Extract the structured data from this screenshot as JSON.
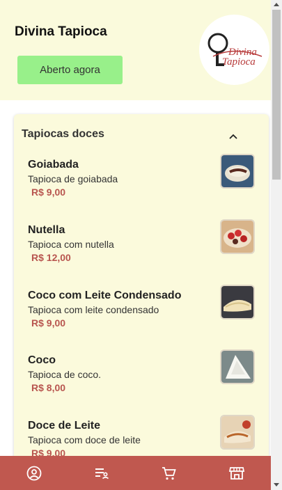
{
  "store": {
    "name": "Divina Tapioca",
    "status": "Aberto agora",
    "logo_text_line1": "Divina",
    "logo_text_line2": "Tapioca"
  },
  "category": {
    "title": "Tapiocas doces",
    "expanded": true,
    "items": [
      {
        "name": "Goiabada",
        "description": "Tapioca de goiabada",
        "price": "R$ 9,00",
        "image": "tapioca-goiabada-photo"
      },
      {
        "name": "Nutella",
        "description": "Tapioca com nutella",
        "price": "R$ 12,00",
        "image": "tapioca-nutella-photo"
      },
      {
        "name": "Coco com Leite Condensado",
        "description": "Tapioca com leite condensado",
        "price": "R$ 9,00",
        "image": "tapioca-coco-leite-photo"
      },
      {
        "name": "Coco",
        "description": "Tapioca de coco.",
        "price": "R$ 8,00",
        "image": "tapioca-coco-photo"
      },
      {
        "name": "Doce de Leite",
        "description": "Tapioca com doce de leite",
        "price": "R$ 9,00",
        "image": "tapioca-doce-de-leite-photo"
      }
    ]
  },
  "bottom_nav": [
    {
      "icon": "user-circle-icon"
    },
    {
      "icon": "menu-list-icon"
    },
    {
      "icon": "cart-icon"
    },
    {
      "icon": "store-icon"
    }
  ],
  "colors": {
    "header_bg": "#fafadc",
    "status_bg": "#98f08a",
    "price": "#b8554f",
    "nav_bg": "#c0584f"
  }
}
